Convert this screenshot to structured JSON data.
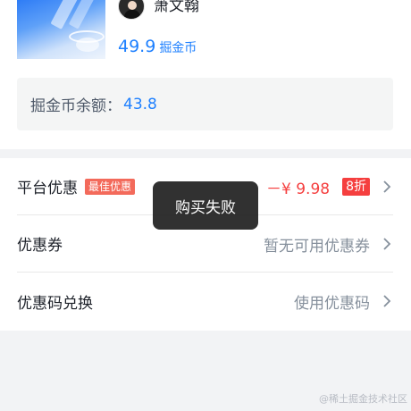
{
  "product": {
    "author": "萧文翰",
    "price": "49.9",
    "price_unit": "掘金币"
  },
  "balance": {
    "label": "掘金币余额：",
    "value": "43.8"
  },
  "rows": [
    {
      "title": "平台优惠",
      "badge": "最佳优惠",
      "discount": "－¥ 9.98",
      "tag": "8折"
    },
    {
      "title": "优惠券",
      "hint": "暂无可用优惠券"
    },
    {
      "title": "优惠码兑换",
      "hint": "使用优惠码"
    }
  ],
  "toast": "购买失败",
  "watermark": "@稀土掘金技术社区",
  "colors": {
    "brand": "#1e80ff",
    "danger": "#f53f3f",
    "badge": "#f36a5b"
  },
  "icons": {
    "chevron": "chevron-right-icon"
  }
}
